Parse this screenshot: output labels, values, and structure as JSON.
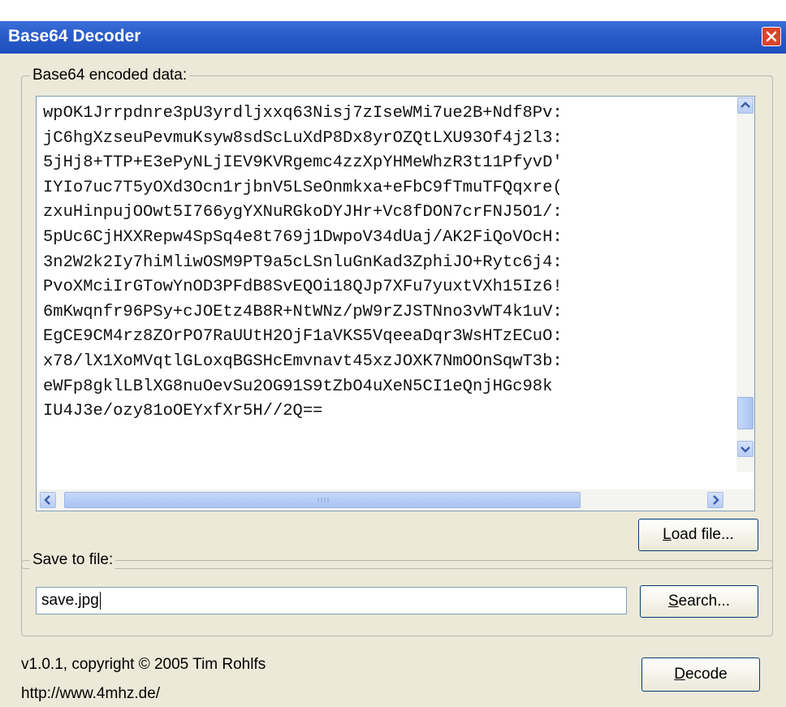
{
  "window": {
    "title": "Base64 Decoder"
  },
  "encoded_group": {
    "label": "Base64 encoded data:",
    "lines": [
      "wpOK1Jrrpdnre3pU3yrdljxxq63Nisj7zIseWMi7ue2B+Ndf8Pv:",
      "jC6hgXzseuPevmuKsyw8sdScLuXdP8Dx8yrOZQtLXU93Of4j2l3:",
      "5jHj8+TTP+E3ePyNLjIEV9KVRgemc4zzXpYHMeWhzR3t11PfyvD'",
      "IYIo7uc7T5yOXd3Ocn1rjbnV5LSeOnmkxa+eFbC9fTmuTFQqxre(",
      "zxuHinpujOOwt5I766ygYXNuRGkoDYJHr+Vc8fDON7crFNJ5O1/:",
      "5pUc6CjHXXRepw4SpSq4e8t769j1DwpoV34dUaj/AK2FiQoVOcH:",
      "3n2W2k2Iy7hiMliwOSM9PT9a5cLSnluGnKad3ZphiJO+Rytc6j4:",
      "PvoXMciIrGTowYnOD3PFdB8SvEQOi18QJp7XFu7yuxtVXh15Iz6!",
      "6mKwqnfr96PSy+cJOEtz4B8R+NtWNz/pW9rZJSTNno3vWT4k1uV:",
      "EgCE9CM4rz8ZOrPO7RaUUtH2OjF1aVKS5VqeeaDqr3WsHTzECuO:",
      "x78/lX1XoMVqtlGLoxqBGSHcEmvnavt45xzJOXK7NmOOnSqwT3b:",
      "eWFp8gklLBlXG8nuOevSu2OG91S9tZbO4uXeN5CI1eQnjHGc98k",
      "IU4J3e/ozy81oOEYxfXr5H//2Q=="
    ],
    "load_button": "Load file...",
    "load_mnemonic": "L",
    "load_rest": "oad file..."
  },
  "save_group": {
    "label": "Save to file:",
    "filename": "save.jpg",
    "search_button": "Search...",
    "search_mnemonic": "S",
    "search_rest": "earch..."
  },
  "footer": {
    "copyright": "v1.0.1, copyright © 2005 Tim Rohlfs",
    "url": "http://www.4mhz.de/",
    "decode_button": "Decode",
    "decode_mnemonic": "D",
    "decode_rest": "ecode"
  },
  "colors": {
    "titlebar": "#2a5bc8",
    "dialog_bg": "#ece9d8",
    "close_button": "#d9442a",
    "scroll_thumb": "#aac3f1"
  },
  "icons": {
    "close": "close-icon",
    "scroll_up": "chevron-up-icon",
    "scroll_down": "chevron-down-icon",
    "scroll_left": "chevron-left-icon",
    "scroll_right": "chevron-right-icon"
  }
}
